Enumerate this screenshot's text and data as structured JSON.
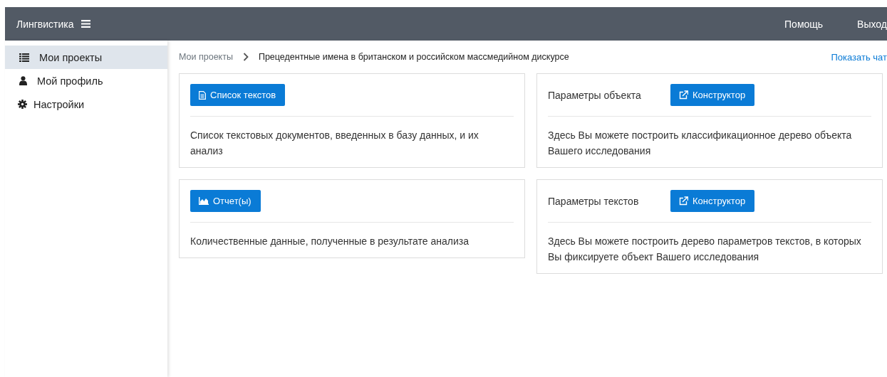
{
  "header": {
    "brand": "Лингвистика",
    "links": [
      "Помощь",
      "Выход"
    ]
  },
  "sidebar": {
    "items": [
      {
        "kind": "list",
        "label": "Мои проекты",
        "selected": true
      },
      {
        "kind": "user",
        "label": "Мой профиль",
        "selected": false
      },
      {
        "kind": "gear",
        "label": "Настройки",
        "selected": false
      }
    ]
  },
  "breadcrumb": {
    "items": [
      "Мои проекты",
      "Прецедентные имена в британском и российском массмедийном дискурсе"
    ],
    "action": "Показать чат"
  },
  "cards": [
    {
      "kind": "document",
      "button": "Список текстов",
      "description": "Список текстовых документов, введенных в базу данных, и их анализ"
    },
    {
      "kind": "constructor",
      "label": "Параметры объекта",
      "button": "Конструктор",
      "description": "Здесь Вы можете построить классификационное дерево объекта Вашего исследования"
    },
    {
      "kind": "chart",
      "button": "Отчет(ы)",
      "description": "Количественные данные, полученные в результате анализа"
    },
    {
      "kind": "constructor",
      "label": "Параметры текстов",
      "button": "Конструктор",
      "description": "Здесь Вы можете построить дерево параметров текстов, в которых Вы фиксируете объект Вашего исследования"
    }
  ]
}
